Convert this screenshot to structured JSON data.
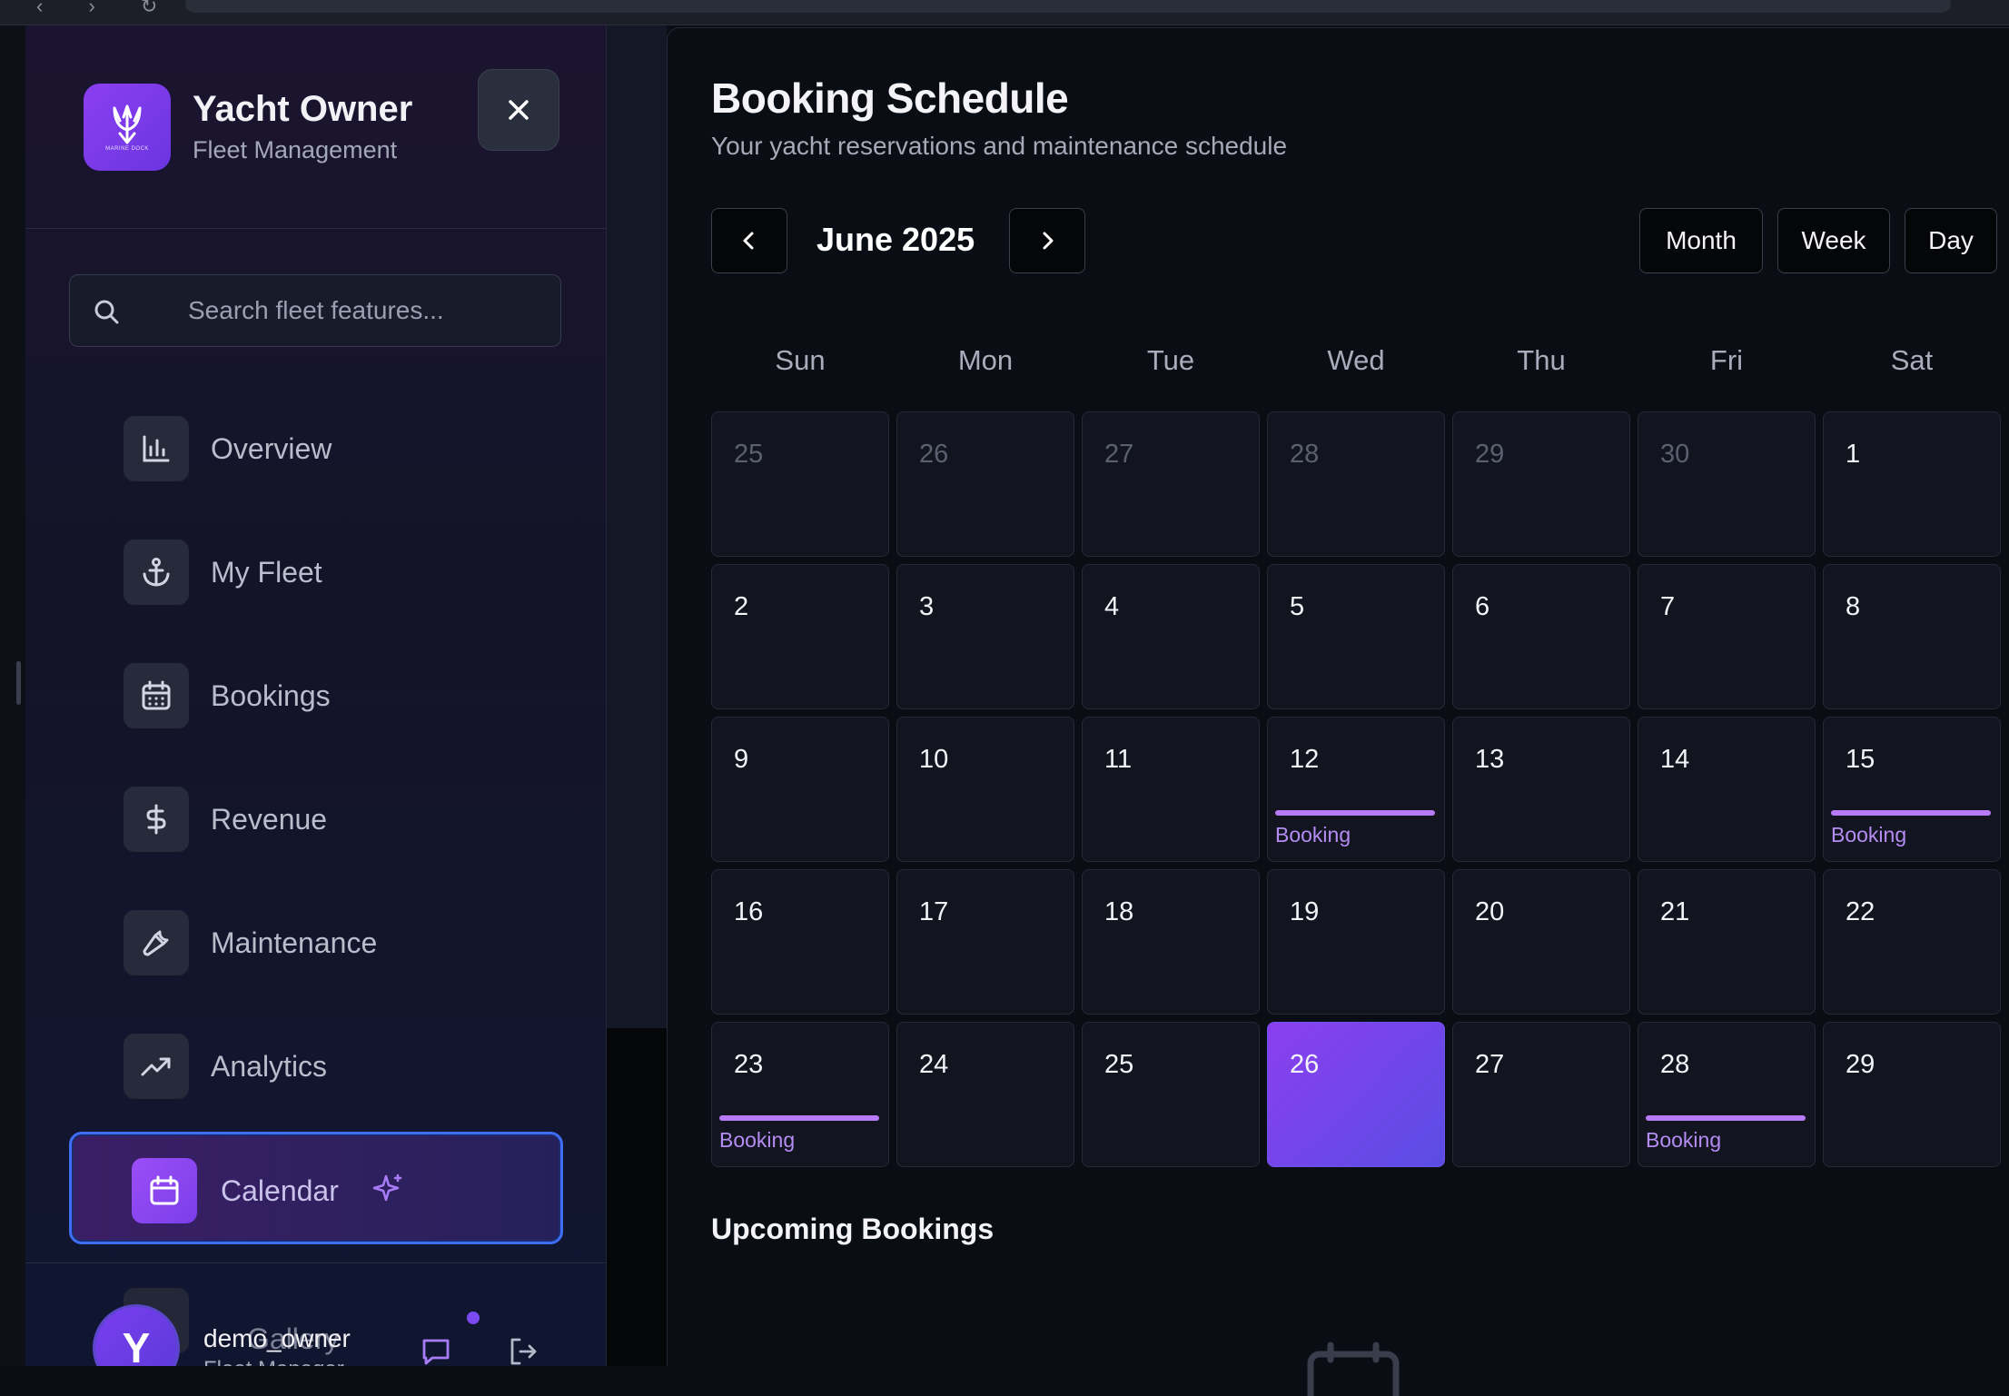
{
  "sidebar": {
    "app_title": "Yacht Owner",
    "app_subtitle": "Fleet Management",
    "logo_text": "MARINE DOCK",
    "search": {
      "placeholder": "Search fleet features..."
    },
    "items": [
      {
        "label": "Overview",
        "icon": "bar-chart-icon"
      },
      {
        "label": "My Fleet",
        "icon": "anchor-icon"
      },
      {
        "label": "Bookings",
        "icon": "calendar-grid-icon"
      },
      {
        "label": "Revenue",
        "icon": "dollar-icon"
      },
      {
        "label": "Maintenance",
        "icon": "wrench-icon"
      },
      {
        "label": "Analytics",
        "icon": "trending-up-icon"
      },
      {
        "label": "Calendar",
        "icon": "calendar-icon",
        "active": true
      },
      {
        "label": "Gallery",
        "icon": "image-icon"
      }
    ],
    "user": {
      "initial": "Y",
      "name": "demo_owner",
      "role": "Fleet Manager"
    }
  },
  "main": {
    "title": "Booking Schedule",
    "subtitle": "Your yacht reservations and maintenance schedule",
    "month_label": "June 2025",
    "views": [
      "Month",
      "Week",
      "Day"
    ],
    "weekdays": [
      "Sun",
      "Mon",
      "Tue",
      "Wed",
      "Thu",
      "Fri",
      "Sat"
    ],
    "weeks": [
      [
        {
          "d": "25",
          "muted": true
        },
        {
          "d": "26",
          "muted": true
        },
        {
          "d": "27",
          "muted": true
        },
        {
          "d": "28",
          "muted": true
        },
        {
          "d": "29",
          "muted": true
        },
        {
          "d": "30",
          "muted": true
        },
        {
          "d": "1"
        }
      ],
      [
        {
          "d": "2"
        },
        {
          "d": "3"
        },
        {
          "d": "4"
        },
        {
          "d": "5"
        },
        {
          "d": "6"
        },
        {
          "d": "7"
        },
        {
          "d": "8"
        }
      ],
      [
        {
          "d": "9"
        },
        {
          "d": "10"
        },
        {
          "d": "11"
        },
        {
          "d": "12",
          "booking": "Booking"
        },
        {
          "d": "13"
        },
        {
          "d": "14"
        },
        {
          "d": "15",
          "booking": "Booking"
        }
      ],
      [
        {
          "d": "16"
        },
        {
          "d": "17"
        },
        {
          "d": "18"
        },
        {
          "d": "19"
        },
        {
          "d": "20"
        },
        {
          "d": "21"
        },
        {
          "d": "22"
        }
      ],
      [
        {
          "d": "23",
          "booking": "Booking"
        },
        {
          "d": "24"
        },
        {
          "d": "25"
        },
        {
          "d": "26",
          "today": true
        },
        {
          "d": "27"
        },
        {
          "d": "28",
          "booking": "Booking"
        },
        {
          "d": "29"
        }
      ]
    ],
    "upcoming_title": "Upcoming Bookings"
  },
  "colors": {
    "accent": "#8b3fee",
    "booking_bar": "#b77cf5",
    "active_border": "#3d6ef5"
  }
}
